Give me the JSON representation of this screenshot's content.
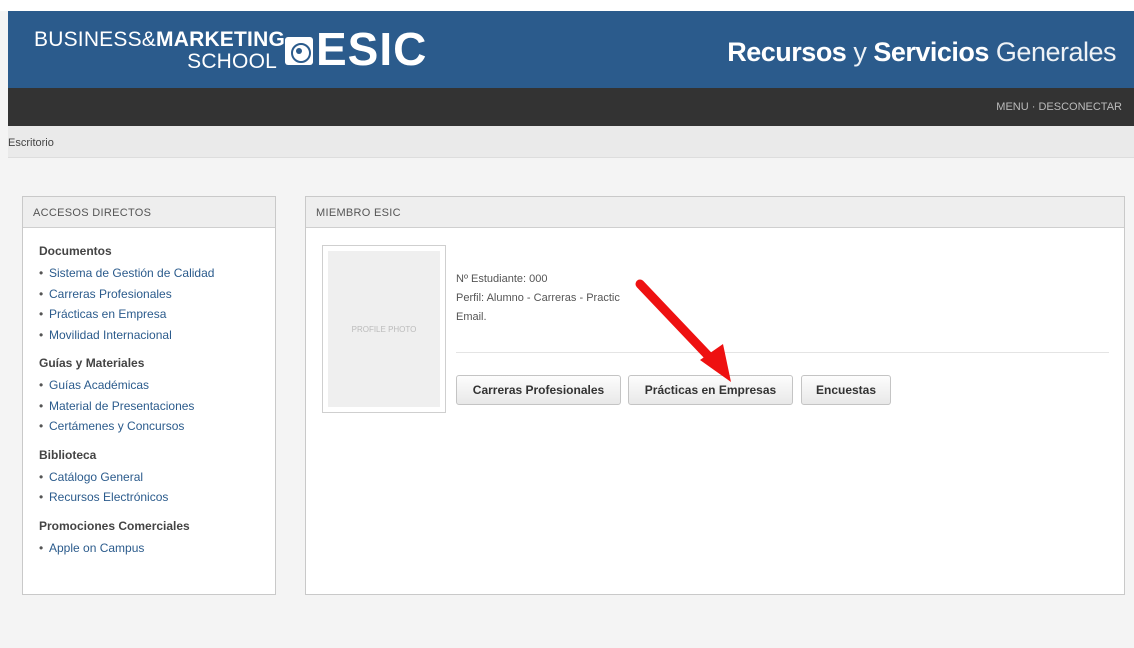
{
  "header": {
    "logo": {
      "line1_regular": "BUSINESS&",
      "line1_bold": "MARKETING",
      "line2": "SCHOOL",
      "brand": "ESIC"
    },
    "title_part1": "Recursos",
    "title_part2": " y ",
    "title_part3": "Servicios",
    "title_part4": " Generales",
    "colors": {
      "brand_blue": "#2b5b8c",
      "navbar": "#333333"
    }
  },
  "nav": {
    "menu": "MENU",
    "separator": " · ",
    "logout": "DESCONECTAR"
  },
  "breadcrumb": "Escritorio",
  "accesos": {
    "title": "ACCESOS DIRECTOS",
    "sections": [
      {
        "title": "Documentos",
        "items": [
          "Sistema de Gestión de Calidad",
          "Carreras Profesionales",
          "Prácticas en Empresa",
          "Movilidad Internacional"
        ]
      },
      {
        "title": "Guías y Materiales",
        "items": [
          "Guías Académicas",
          "Material de Presentaciones",
          "Certámenes y Concursos"
        ]
      },
      {
        "title": "Biblioteca",
        "items": [
          "Catálogo General",
          "Recursos Electrónicos"
        ]
      },
      {
        "title": "Promociones Comerciales",
        "items": [
          "Apple on Campus"
        ]
      }
    ]
  },
  "miembro": {
    "title": "MIEMBRO ESIC",
    "photo_placeholder": "PROFILE PHOTO",
    "student_number": "Nº Estudiante: 000",
    "profile": "Perfil: Alumno - Carreras - Practic",
    "email": "Email.",
    "buttons": [
      "Carreras Profesionales",
      "Prácticas en Empresas",
      "Encuestas"
    ]
  },
  "annotation": {
    "arrow_color": "#ee1111"
  }
}
